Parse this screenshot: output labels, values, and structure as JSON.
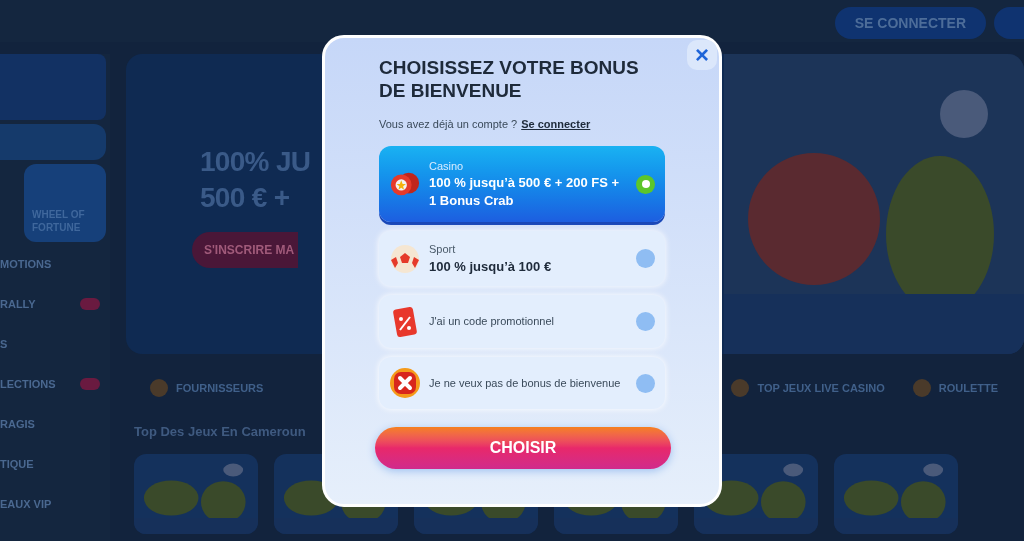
{
  "background": {
    "header": {
      "login_button": "SE CONNECTER"
    },
    "sidebar": {
      "promo_card": "WHEEL OF FORTUNE",
      "items": [
        {
          "label": "MOTIONS",
          "badge": false
        },
        {
          "label": "RALLY",
          "badge": true
        },
        {
          "label": "S",
          "badge": false
        },
        {
          "label": "LECTIONS",
          "badge": true
        },
        {
          "label": "RAGIS",
          "badge": false
        },
        {
          "label": "TIQUE",
          "badge": false
        },
        {
          "label": "EAUX VIP",
          "badge": false
        }
      ]
    },
    "banner": {
      "line_1": "100% JU",
      "line_2": "500 € +",
      "button": "S'INSCRIRE MA"
    },
    "categories": [
      "FOURNISSEURS",
      "TOP JEUX LIVE CASINO",
      "ROULETTE"
    ],
    "section_title": "Top Des Jeux En Cameroun"
  },
  "modal": {
    "title": "CHOISISSEZ VOTRE BONUS DE BIENVENUE",
    "account_prompt": "Vous avez déjà un compte ?",
    "login_link": "Se connecter",
    "options": [
      {
        "kind": "chips",
        "category": "Casino",
        "text": "100 % jusqu’à 500 € + 200 FS + 1 Bonus Crab",
        "selected": true
      },
      {
        "kind": "ball",
        "category": "Sport",
        "text": "100 % jusqu’à 100 €",
        "selected": false
      },
      {
        "kind": "coupon",
        "text": "J'ai un code promotionnel",
        "selected": false
      },
      {
        "kind": "cross",
        "text": "Je ne veux pas de bonus de bienvenue",
        "selected": false
      }
    ],
    "close_button": "×",
    "choose_button": "CHOISIR"
  }
}
